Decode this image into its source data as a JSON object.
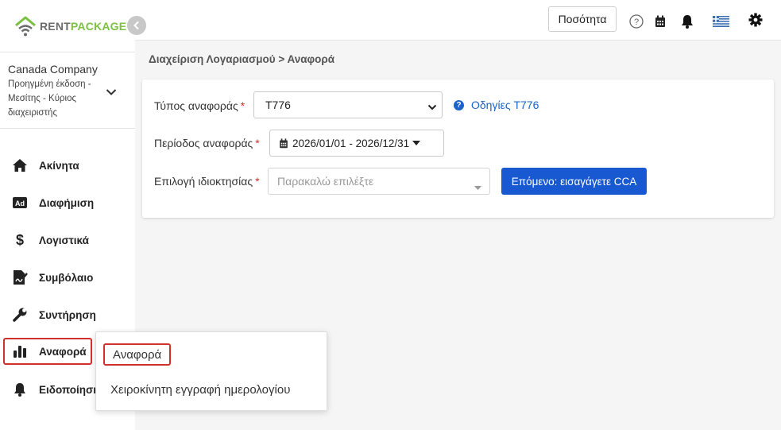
{
  "brand": {
    "rent": "RENT",
    "package": "PACKAGE"
  },
  "company": {
    "name": "Canada Company",
    "plan": "Προηγμένη έκδοση - Μεσίτης - Κύριος διαχειριστής"
  },
  "sidebar": {
    "items": [
      {
        "label": "Ακίνητα",
        "icon": "home-icon"
      },
      {
        "label": "Διαφήμιση",
        "icon": "ad-icon"
      },
      {
        "label": "Λογιστικά",
        "icon": "dollar-icon"
      },
      {
        "label": "Συμβόλαιο",
        "icon": "contract-signature-icon"
      },
      {
        "label": "Συντήρηση",
        "icon": "wrench-icon"
      },
      {
        "label": "Αναφορά",
        "icon": "bar-chart-icon",
        "active": true
      },
      {
        "label": "Ειδοποίηση",
        "icon": "bell-icon"
      }
    ]
  },
  "topbar": {
    "quantity_button": "Ποσότητα",
    "icons": [
      "help-icon",
      "calendar-icon",
      "bell-icon",
      "greek-flag-icon",
      "gear-icon"
    ]
  },
  "breadcrumb": "Διαχείριση Λογαριασμού > Αναφορά",
  "form": {
    "report_type_label": "Τύπος αναφοράς",
    "report_type_value": "T776",
    "help_link": "Οδηγίες T776",
    "period_label": "Περίοδος αναφοράς",
    "period_value": "2026/01/01 - 2026/12/31",
    "property_label": "Επιλογή ιδιοκτησίας",
    "property_placeholder": "Παρακαλώ επιλέξτε",
    "next_button": "Επόμενο: εισαγάγετε CCA",
    "required_mark": "*"
  },
  "popup": {
    "items": [
      "Αναφορά",
      "Χειροκίνητη εγγραφή ημερολογίου"
    ]
  },
  "colors": {
    "accent": "#1858d0",
    "brand_green": "#7cc142",
    "highlight_red": "#d0312d"
  }
}
